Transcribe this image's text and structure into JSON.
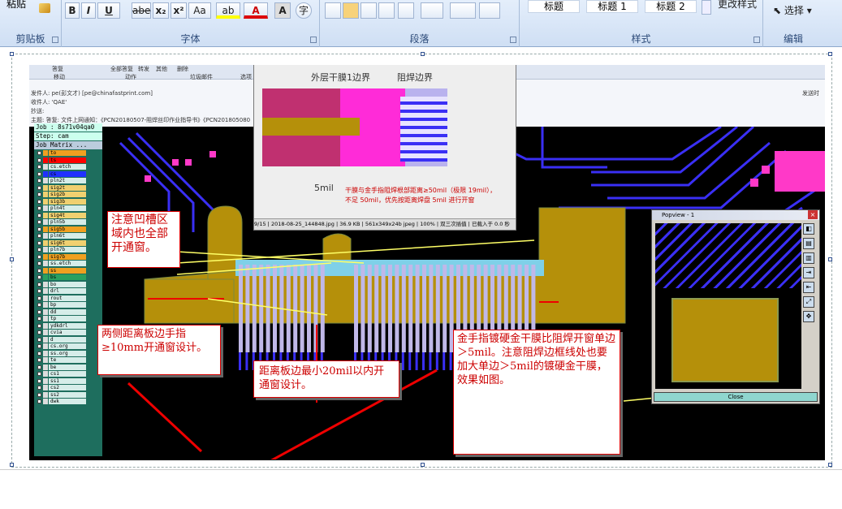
{
  "ribbon": {
    "clipboard": {
      "paste": "粘贴",
      "label": "剪贴板"
    },
    "font": {
      "label": "字体",
      "bold": "B",
      "italic": "I",
      "underline": "U",
      "strike": "abe",
      "sub": "x₂",
      "sup": "x²",
      "case": "Aa",
      "highlight": "ab",
      "color": "A",
      "charbox": "A",
      "phonetic": "字"
    },
    "paragraph": {
      "label": "段落"
    },
    "styles": {
      "label": "样式",
      "items": [
        "标题",
        "标题 1",
        "标题 2"
      ],
      "change": "更改样式"
    },
    "editing": {
      "label": "编辑",
      "select": "选择"
    }
  },
  "email": {
    "toolbar": [
      "答复",
      "全部答复",
      "转发",
      "其他",
      "删除",
      "移动",
      "动作",
      "垃圾邮件",
      "选项"
    ],
    "from_label": "发件人:",
    "from": "pe(彭文才) [pe@chinafastprint.com]",
    "to_label": "收件人:",
    "to": "'QAE'",
    "cc_label": "抄送:",
    "cc": "",
    "subject_label": "主题:",
    "subject": "答复: 文件上网通知：《PCN20180507-阻焊丝印作业指导书》《PCN201805080",
    "sent_label": "发送时"
  },
  "job": {
    "title": "Job : 8s71v04qa0",
    "step": "Step: cam",
    "matrix": "Job Matrix ...",
    "layers": [
      {
        "name": "to",
        "color": "#f0a020"
      },
      {
        "name": "ts",
        "color": "#f00"
      },
      {
        "name": "cs.etch",
        "color": "#ddd"
      },
      {
        "name": "cs",
        "color": "#2030ff"
      },
      {
        "name": "pln2t",
        "color": "#ddd"
      },
      {
        "name": "sig2t",
        "color": "#f0d070"
      },
      {
        "name": "sig2b",
        "color": "#f0d070"
      },
      {
        "name": "sig3b",
        "color": "#f0d070"
      },
      {
        "name": "pln4t",
        "color": "#ddd"
      },
      {
        "name": "sig4t",
        "color": "#f0d070"
      },
      {
        "name": "pln5b",
        "color": "#ddd"
      },
      {
        "name": "sig5b",
        "color": "#f0a020"
      },
      {
        "name": "pln6t",
        "color": "#ddd"
      },
      {
        "name": "sig6t",
        "color": "#f0d070"
      },
      {
        "name": "pln7b",
        "color": "#ddd"
      },
      {
        "name": "sig7b",
        "color": "#f0a020"
      },
      {
        "name": "ss.etch",
        "color": "#ddd"
      },
      {
        "name": "ss",
        "color": "#f0a020"
      },
      {
        "name": "bs",
        "color": "#2aa060"
      },
      {
        "name": "bo",
        "color": "#ddd"
      },
      {
        "name": "drl",
        "color": "#ddd"
      },
      {
        "name": "rout",
        "color": "#ddd"
      },
      {
        "name": "bp",
        "color": "#ddd"
      },
      {
        "name": "dd",
        "color": "#ddd"
      },
      {
        "name": "tp",
        "color": "#ddd"
      },
      {
        "name": "ydkdrl",
        "color": "#ddd"
      },
      {
        "name": "cvia",
        "color": "#ddd"
      },
      {
        "name": "d",
        "color": "#ddd"
      },
      {
        "name": "cs.org",
        "color": "#ddd"
      },
      {
        "name": "ss.org",
        "color": "#ddd"
      },
      {
        "name": "te",
        "color": "#ddd"
      },
      {
        "name": "be",
        "color": "#ddd"
      },
      {
        "name": "cs1",
        "color": "#ddd"
      },
      {
        "name": "ss1",
        "color": "#ddd"
      },
      {
        "name": "cs2",
        "color": "#ddd"
      },
      {
        "name": "ss2",
        "color": "#ddd"
      },
      {
        "name": "dwk",
        "color": "#ddd"
      }
    ]
  },
  "popup": {
    "label_left": "外层干膜1边界",
    "label_right": "阻焊边界",
    "dim": "5mil",
    "note1": "干膜与金手指阻焊根部距离≥50mil（极限 19mil），",
    "note2": "不足 50mil，优先按距离焊盘 5mil 进行开窗",
    "status": [
      "9/15",
      "2018-08-25_144848.jpg",
      "36.9 KB",
      "561x349x24b jpeg",
      "100%",
      "双三次插值",
      "已载入于 0.0 秒"
    ]
  },
  "notes": {
    "groove": "注意凹槽区域内也全部开通窗。",
    "sides": "两侧距离板边手指≥10mm开通窗设计。",
    "edge": "距离板边最小20mil以内开通窗设计。",
    "gold": "金手指镀硬金干膜比阻焊开窗单边＞5mil。注意阻焊边框线处也要加大单边＞5mil的镀硬金干膜，效果如图。"
  },
  "popview": {
    "title": "Popview - 1",
    "close": "Close"
  },
  "colors": {
    "gold": "#b5900a",
    "trace": "#3a2ff5",
    "mask": "#7fd0e8",
    "pad": "#c0b8e8"
  }
}
